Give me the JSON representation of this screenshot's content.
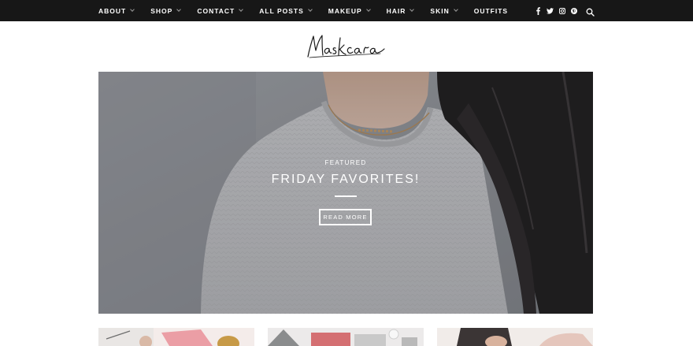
{
  "nav": {
    "items": [
      {
        "label": "ABOUT",
        "has_dropdown": true
      },
      {
        "label": "SHOP",
        "has_dropdown": true
      },
      {
        "label": "CONTACT",
        "has_dropdown": true
      },
      {
        "label": "ALL POSTS",
        "has_dropdown": true
      },
      {
        "label": "MAKEUP",
        "has_dropdown": true
      },
      {
        "label": "HAIR",
        "has_dropdown": true
      },
      {
        "label": "SKIN",
        "has_dropdown": true
      },
      {
        "label": "OUTFITS",
        "has_dropdown": false
      }
    ],
    "social_icons": [
      "facebook-icon",
      "twitter-icon",
      "instagram-icon",
      "pinterest-icon"
    ],
    "search_icon": "search-icon"
  },
  "logo": {
    "text": "Maskcara"
  },
  "hero": {
    "kicker": "FEATURED",
    "title": "FRIDAY FAVORITES!",
    "button": "READ MORE"
  },
  "colors": {
    "topbar": "#171717",
    "nav_text": "#ffffff",
    "chevron": "#9a9a9a",
    "page_bg": "#ffffff"
  }
}
